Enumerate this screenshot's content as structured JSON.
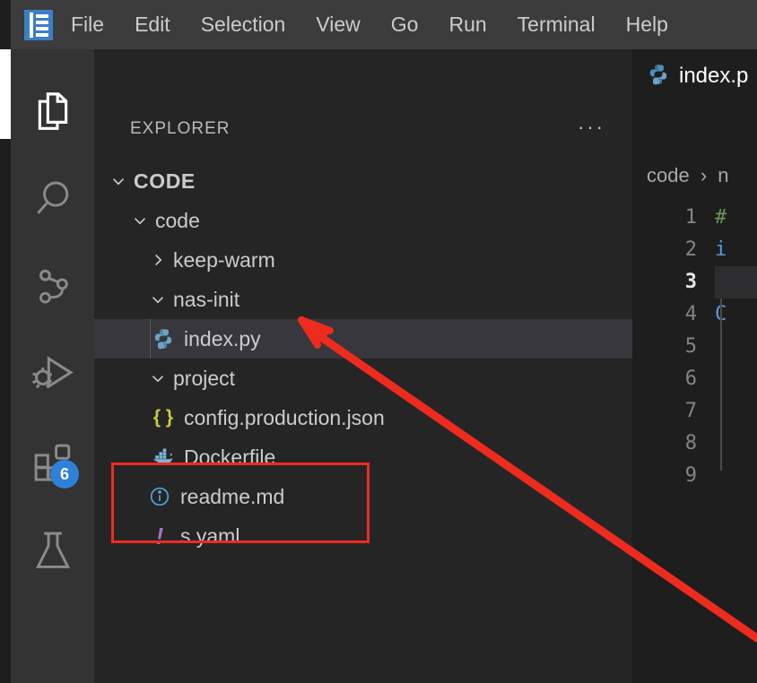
{
  "window": {
    "app_logo": "vscode-logo-icon"
  },
  "menubar": {
    "items": [
      {
        "label": "File"
      },
      {
        "label": "Edit"
      },
      {
        "label": "Selection"
      },
      {
        "label": "View"
      },
      {
        "label": "Go"
      },
      {
        "label": "Run"
      },
      {
        "label": "Terminal"
      },
      {
        "label": "Help"
      }
    ]
  },
  "activitybar": {
    "items": [
      {
        "name": "explorer",
        "icon": "files-icon",
        "active": true,
        "badge": null
      },
      {
        "name": "search",
        "icon": "search-icon",
        "active": false,
        "badge": null
      },
      {
        "name": "source-control",
        "icon": "source-control-icon",
        "active": false,
        "badge": null
      },
      {
        "name": "run-and-debug",
        "icon": "run-debug-icon",
        "active": false,
        "badge": null
      },
      {
        "name": "extensions",
        "icon": "extensions-icon",
        "active": false,
        "badge": "6"
      },
      {
        "name": "testing",
        "icon": "beaker-icon",
        "active": false,
        "badge": null
      }
    ],
    "badge_color": "#2f80d8"
  },
  "sidebar": {
    "title": "EXPLORER",
    "more_actions": "···",
    "tree": [
      {
        "label": "CODE",
        "kind": "root-folder",
        "expanded": true,
        "indent": 0,
        "icon": "chevron-down-icon",
        "selected": false
      },
      {
        "label": "code",
        "kind": "folder",
        "expanded": true,
        "indent": 1,
        "icon": "chevron-down-icon",
        "selected": false
      },
      {
        "label": "keep-warm",
        "kind": "folder",
        "expanded": false,
        "indent": 2,
        "icon": "chevron-right-icon",
        "selected": false
      },
      {
        "label": "nas-init",
        "kind": "folder",
        "expanded": true,
        "indent": 2,
        "icon": "chevron-down-icon",
        "selected": false
      },
      {
        "label": "index.py",
        "kind": "file-python",
        "expanded": null,
        "indent": 3,
        "icon": "python-icon",
        "selected": true
      },
      {
        "label": "project",
        "kind": "folder",
        "expanded": true,
        "indent": 2,
        "icon": "chevron-down-icon",
        "selected": false
      },
      {
        "label": "config.production.json",
        "kind": "file-json",
        "expanded": null,
        "indent": 3,
        "icon": "json-icon",
        "selected": false
      },
      {
        "label": "Dockerfile",
        "kind": "file-docker",
        "expanded": null,
        "indent": 3,
        "icon": "docker-icon",
        "selected": false
      },
      {
        "label": "readme.md",
        "kind": "file-markdown",
        "expanded": null,
        "indent": 2,
        "icon": "info-icon",
        "selected": false
      },
      {
        "label": "s.yaml",
        "kind": "file-yaml",
        "expanded": null,
        "indent": 2,
        "icon": "yaml-bang-icon",
        "selected": false
      }
    ]
  },
  "editor": {
    "tab": {
      "icon": "python-icon",
      "title": "index.p"
    },
    "breadcrumb": {
      "parts": [
        "code",
        "n"
      ],
      "separator": "›"
    },
    "line_numbers": [
      "1",
      "2",
      "3",
      "4",
      "5",
      "6",
      "7",
      "8",
      "9"
    ],
    "active_line": "3",
    "code_fragments": [
      {
        "line": "1",
        "text": "#",
        "token": "comment"
      },
      {
        "line": "2",
        "text": "i",
        "token": "keyword"
      },
      {
        "line": "3",
        "text": "",
        "token": "plain"
      },
      {
        "line": "4",
        "text": "C",
        "token": "type"
      },
      {
        "line": "5",
        "text": "",
        "token": "plain"
      },
      {
        "line": "6",
        "text": "",
        "token": "plain"
      },
      {
        "line": "7",
        "text": "",
        "token": "plain"
      },
      {
        "line": "8",
        "text": "",
        "token": "plain"
      },
      {
        "line": "9",
        "text": "",
        "token": "plain"
      }
    ]
  },
  "annotations": {
    "highlight_box": {
      "target": "s.yaml",
      "color": "#ee2b1f"
    },
    "arrow": {
      "color": "#ee2b1f",
      "points_to": "project"
    }
  },
  "colors": {
    "menubar_bg": "#3c3c3c",
    "activitybar_bg": "#333333",
    "sidebar_bg": "#252526",
    "editor_bg": "#1e1e1e",
    "selected_row_bg": "#37373d",
    "text": "#cccccc",
    "accent": "#2f80d8",
    "annotation_red": "#ee2b1f"
  }
}
